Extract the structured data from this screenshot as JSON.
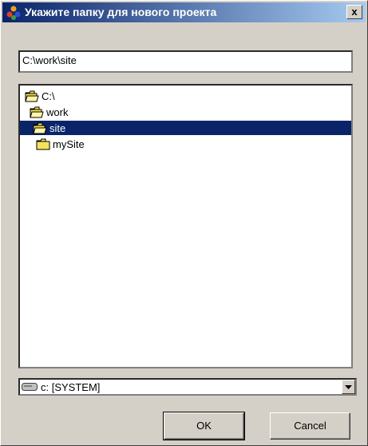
{
  "dialog": {
    "title": "Укажите папку для нового проекта",
    "close_label": "x"
  },
  "path_field": {
    "value": "C:\\work\\site"
  },
  "tree": {
    "items": [
      {
        "label": "C:\\",
        "level": 0,
        "state": "open",
        "selected": false
      },
      {
        "label": "work",
        "level": 1,
        "state": "open",
        "selected": false
      },
      {
        "label": "site",
        "level": 2,
        "state": "open",
        "selected": true
      },
      {
        "label": "mySite",
        "level": 3,
        "state": "closed",
        "selected": false
      }
    ]
  },
  "drive_select": {
    "value": "c: [SYSTEM]",
    "icon": "drive-icon"
  },
  "buttons": {
    "ok_label": "OK",
    "cancel_label": "Cancel"
  },
  "colors": {
    "title_gradient_start": "#0a246a",
    "title_gradient_end": "#a6caf0",
    "selection": "#0a246a",
    "face": "#d4d0c8",
    "folder": "#f5e35c"
  }
}
